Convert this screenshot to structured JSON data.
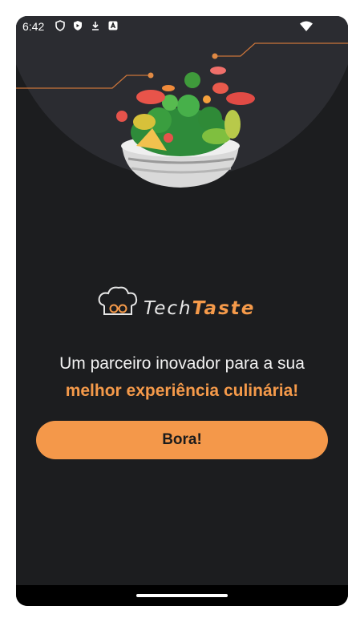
{
  "status_bar": {
    "time": "6:42",
    "icons": [
      "shield-icon",
      "play-protect-icon",
      "download-icon",
      "accessibility-icon"
    ],
    "wifi_icon": "wifi-icon"
  },
  "hero": {
    "image": "salad-bowl-illustration"
  },
  "brand": {
    "part1": "Tech",
    "part2": "Taste",
    "logo_icon": "chef-hat-glasses-icon"
  },
  "tagline": {
    "line1": "Um parceiro inovador para a sua",
    "line2": "melhor experiência culinária!"
  },
  "cta": {
    "label": "Bora!"
  },
  "colors": {
    "background": "#1c1d1f",
    "accent": "#f4984a",
    "hero_circle": "#2b2c31"
  }
}
